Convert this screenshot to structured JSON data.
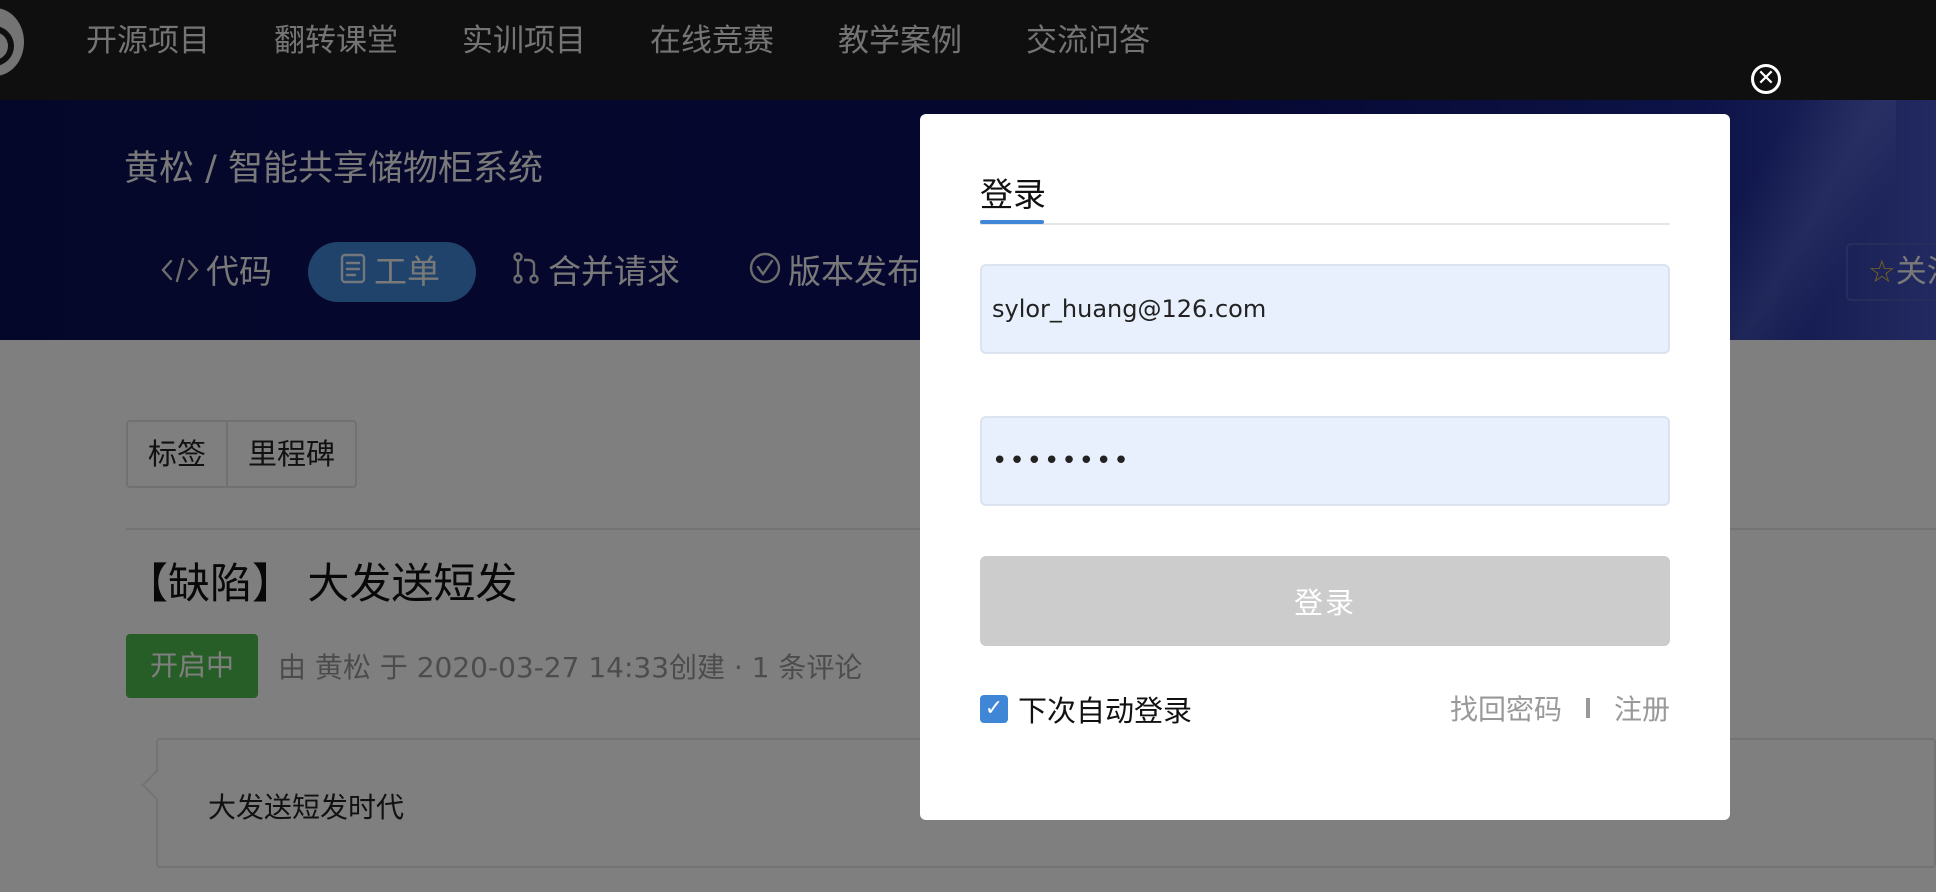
{
  "topnav": {
    "items": [
      "开源项目",
      "翻转课堂",
      "实训项目",
      "在线竞赛",
      "教学案例",
      "交流问答"
    ]
  },
  "project": {
    "breadcrumb": "黄松 / 智能共享储物柜系统",
    "tabs": [
      {
        "label": "代码",
        "icon": "code-icon"
      },
      {
        "label": "工单",
        "icon": "clipboard-icon",
        "active": true
      },
      {
        "label": "合并请求",
        "icon": "merge-icon"
      },
      {
        "label": "版本发布",
        "icon": "check-circle-icon"
      }
    ],
    "star_label": "关注"
  },
  "issue": {
    "filters": [
      "标签",
      "里程碑"
    ],
    "title": "【缺陷】 大发送短发",
    "state": "开启中",
    "meta": "由 黄松 于 2020-03-27 14:33创建 · 1 条评论",
    "comment": "大发送短发时代"
  },
  "login_modal": {
    "tab_label": "登录",
    "email_value": "sylor_huang@126.com",
    "password_value": "••••••••",
    "submit_label": "登录",
    "remember_label": "下次自动登录",
    "remember_checked": true,
    "forgot_label": "找回密码",
    "register_label": "注册"
  },
  "colors": {
    "nav_bg": "#1f1f1f",
    "banner_bg": "#0b0f55",
    "accent": "#3f86d6",
    "open_state": "#4fbb4f",
    "disabled_button": "#cccccc",
    "field_bg": "#e8f0fe"
  }
}
